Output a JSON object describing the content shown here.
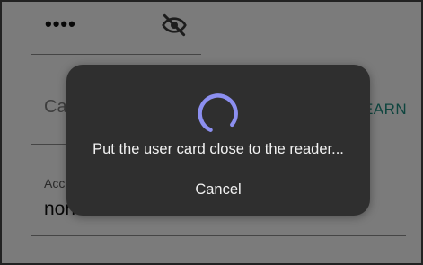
{
  "form": {
    "password_value": "••••",
    "card_number_label": "Card number",
    "learn_label": "LEARN",
    "access_type_label": "Access type",
    "access_type_value": "normal"
  },
  "dialog": {
    "message": "Put the user card close to the reader...",
    "cancel_label": "Cancel"
  },
  "icons": {
    "password_visibility": "eye-off-icon",
    "learn": "card-icon",
    "progress": "spinner-icon"
  },
  "colors": {
    "accent": "#1c8b7e",
    "spinner": "#8c8ff0",
    "dialog_bg": "#2f2f2f"
  }
}
